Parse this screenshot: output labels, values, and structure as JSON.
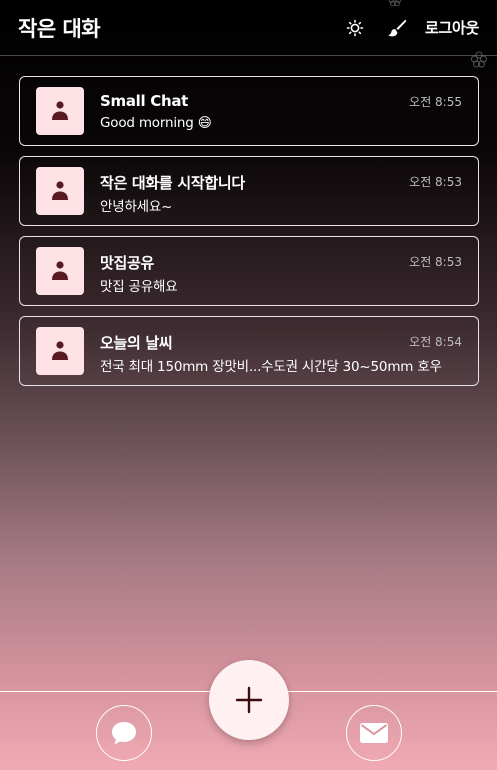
{
  "header": {
    "title": "작은 대화",
    "theme_icon": "sun-icon",
    "paint_icon": "paintbrush-icon",
    "logout_label": "로그아웃"
  },
  "chat_rooms": [
    {
      "title": "Small Chat",
      "last_message": "Good morning 😄",
      "time": "오전 8:55"
    },
    {
      "title": "작은 대화를 시작합니다",
      "last_message": "안녕하세요~",
      "time": "오전 8:53"
    },
    {
      "title": "맛집공유",
      "last_message": "맛집 공유해요",
      "time": "오전 8:53"
    },
    {
      "title": "오늘의 날씨",
      "last_message": "전국 최대 150mm 장맛비...수도권 시간당 30~50mm 호우",
      "time": "오전 8:54"
    }
  ],
  "bottom_nav": {
    "chat_icon": "chat-bubble-icon",
    "add_icon": "plus-icon",
    "mail_icon": "envelope-icon"
  },
  "colors": {
    "avatar_bg": "#fde1e4",
    "avatar_fg": "#5a1a24",
    "fab_bg": "#fff1f2",
    "gradient_bottom": "#f0aab4"
  }
}
